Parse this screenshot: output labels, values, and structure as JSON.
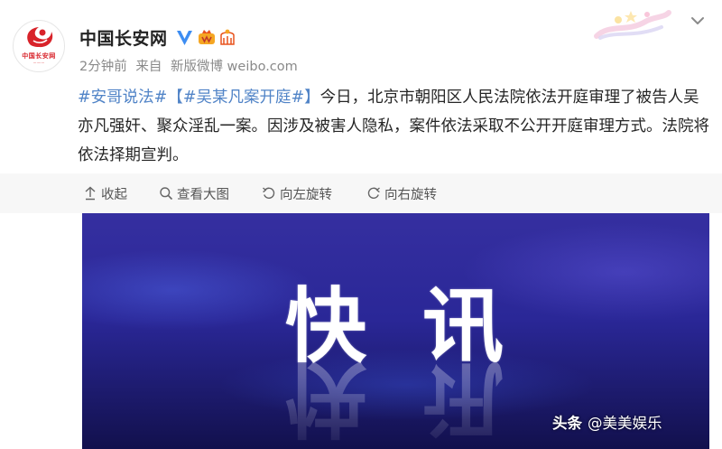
{
  "post": {
    "account_name": "中国长安网",
    "avatar_logo_text": "中国长安网",
    "time": "2分钟前",
    "source_prefix": "来自",
    "source": "新版微博 weibo.com",
    "tag1": "#安哥说法#",
    "tag2": "【#吴某凡案开庭#】",
    "body": "今日，北京市朝阳区人民法院依法开庭审理了被告人吴亦凡强奸、聚众淫乱一案。因涉及被害人隐私，案件依法采取不公开开庭审理方式。法院将依法择期宣判。"
  },
  "toolbar": {
    "collapse": "收起",
    "view_large": "查看大图",
    "rotate_left": "向左旋转",
    "rotate_right": "向右旋转"
  },
  "image": {
    "headline": "快讯"
  },
  "watermark": {
    "brand": "头条",
    "author": "@美美娱乐"
  },
  "colors": {
    "tag_blue": "#5184c7",
    "brand_red": "#d8232a",
    "banner_blue": "#2a2797"
  },
  "icons": [
    "verified-icon",
    "member-icon",
    "medal-icon",
    "chevron-down-icon",
    "collapse-icon",
    "zoom-icon",
    "rotate-left-icon",
    "rotate-right-icon"
  ]
}
